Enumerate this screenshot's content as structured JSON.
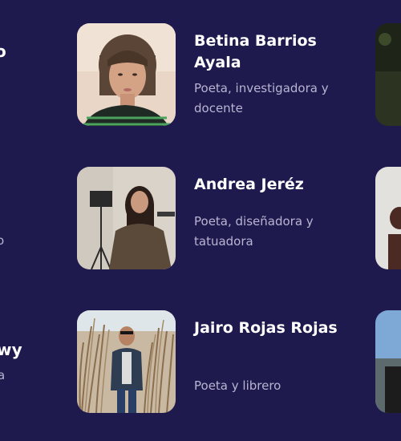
{
  "left_column": {
    "fragment_1": "o",
    "fragment_2": "o",
    "fragment_3": "wy",
    "fragment_4": "a"
  },
  "people": [
    {
      "name": "Betina Barrios Ayala",
      "role": "Poeta, investigadora y docente",
      "photo_icon": "person-photo"
    },
    {
      "name": "Andrea Jeréz",
      "role": "Poeta, diseñadora y tatuadora",
      "photo_icon": "person-photo"
    },
    {
      "name": "Jairo Rojas Rojas",
      "role": "Poeta y librero",
      "photo_icon": "person-photo"
    }
  ],
  "colors": {
    "background": "#1f1a4d",
    "name": "#ffffff",
    "role": "#b8b4d2"
  }
}
